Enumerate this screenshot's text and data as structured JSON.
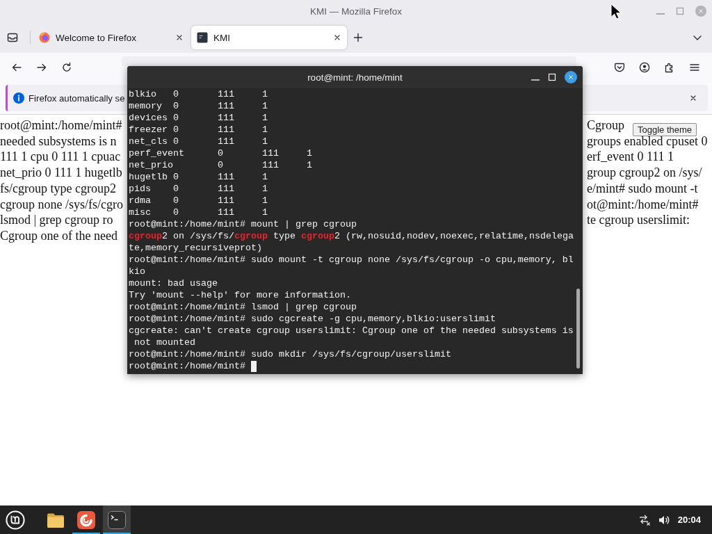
{
  "firefox": {
    "title": "KMI — Mozilla Firefox",
    "tabs": [
      {
        "label": "Welcome to Firefox",
        "kind": "welcome",
        "selected": false
      },
      {
        "label": "KMI",
        "kind": "page",
        "selected": true
      }
    ],
    "notification": {
      "text": "Firefox automatically se"
    },
    "page": {
      "left_lines": [
        "root@mint:/home/mint#",
        "needed subsystems is n",
        "111 1 cpu 0 111 1 cpuac",
        "net_prio 0 111 1 hugetlb",
        "fs/cgroup type cgroup2",
        "cgroup none /sys/fs/cgro",
        "lsmod | grep cgroup ro",
        "Cgroup one of the need"
      ],
      "right_lines": [
        "Cgroup",
        "groups enabled cpuset 0",
        "erf_event 0 111 1",
        "group cgroup2 on /sys/",
        "e/mint# sudo mount -t",
        "ot@mint:/home/mint#",
        "te cgroup userslimit:"
      ],
      "tooltip": "Toggle theme"
    }
  },
  "terminal": {
    "title": "root@mint: /home/mint",
    "lines": [
      "blkio   0       111     1",
      "memory  0       111     1",
      "devices 0       111     1",
      "freezer 0       111     1",
      "net_cls 0       111     1",
      "perf_event      0       111     1",
      "net_prio        0       111     1",
      "hugetlb 0       111     1",
      "pids    0       111     1",
      "rdma    0       111     1",
      "misc    0       111     1",
      "root@mint:/home/mint# mount | grep cgroup",
      {
        "parts": [
          {
            "text": "cgroup",
            "highlight": true
          },
          {
            "text": "2 on /sys/fs/",
            "highlight": false
          },
          {
            "text": "cgroup",
            "highlight": true
          },
          {
            "text": " type ",
            "highlight": false
          },
          {
            "text": "cgroup",
            "highlight": true
          },
          {
            "text": "2 (rw,nosuid,nodev,noexec,relatime,nsdelega",
            "highlight": false
          }
        ]
      },
      "te,memory_recursiveprot)",
      "root@mint:/home/mint# sudo mount -t cgroup none /sys/fs/cgroup -o cpu,memory, bl",
      "kio",
      "mount: bad usage",
      "Try 'mount --help' for more information.",
      "root@mint:/home/mint# lsmod | grep cgroup",
      "root@mint:/home/mint# sudo cgcreate -g cpu,memory,blkio:userslimit",
      "cgcreate: can't create cgroup userslimit: Cgroup one of the needed subsystems is",
      " not mounted",
      "root@mint:/home/mint# sudo mkdir /sys/fs/cgroup/userslimit"
    ],
    "input_line": {
      "text": "root@mint:/home/mint#",
      "cursor": true
    }
  },
  "taskbar": {
    "apps": [
      {
        "kind": "folder",
        "running": false,
        "selected": false
      },
      {
        "kind": "browser",
        "running": true,
        "selected": false
      },
      {
        "kind": "terminal",
        "running": true,
        "selected": true
      }
    ],
    "clock": "20:04"
  }
}
